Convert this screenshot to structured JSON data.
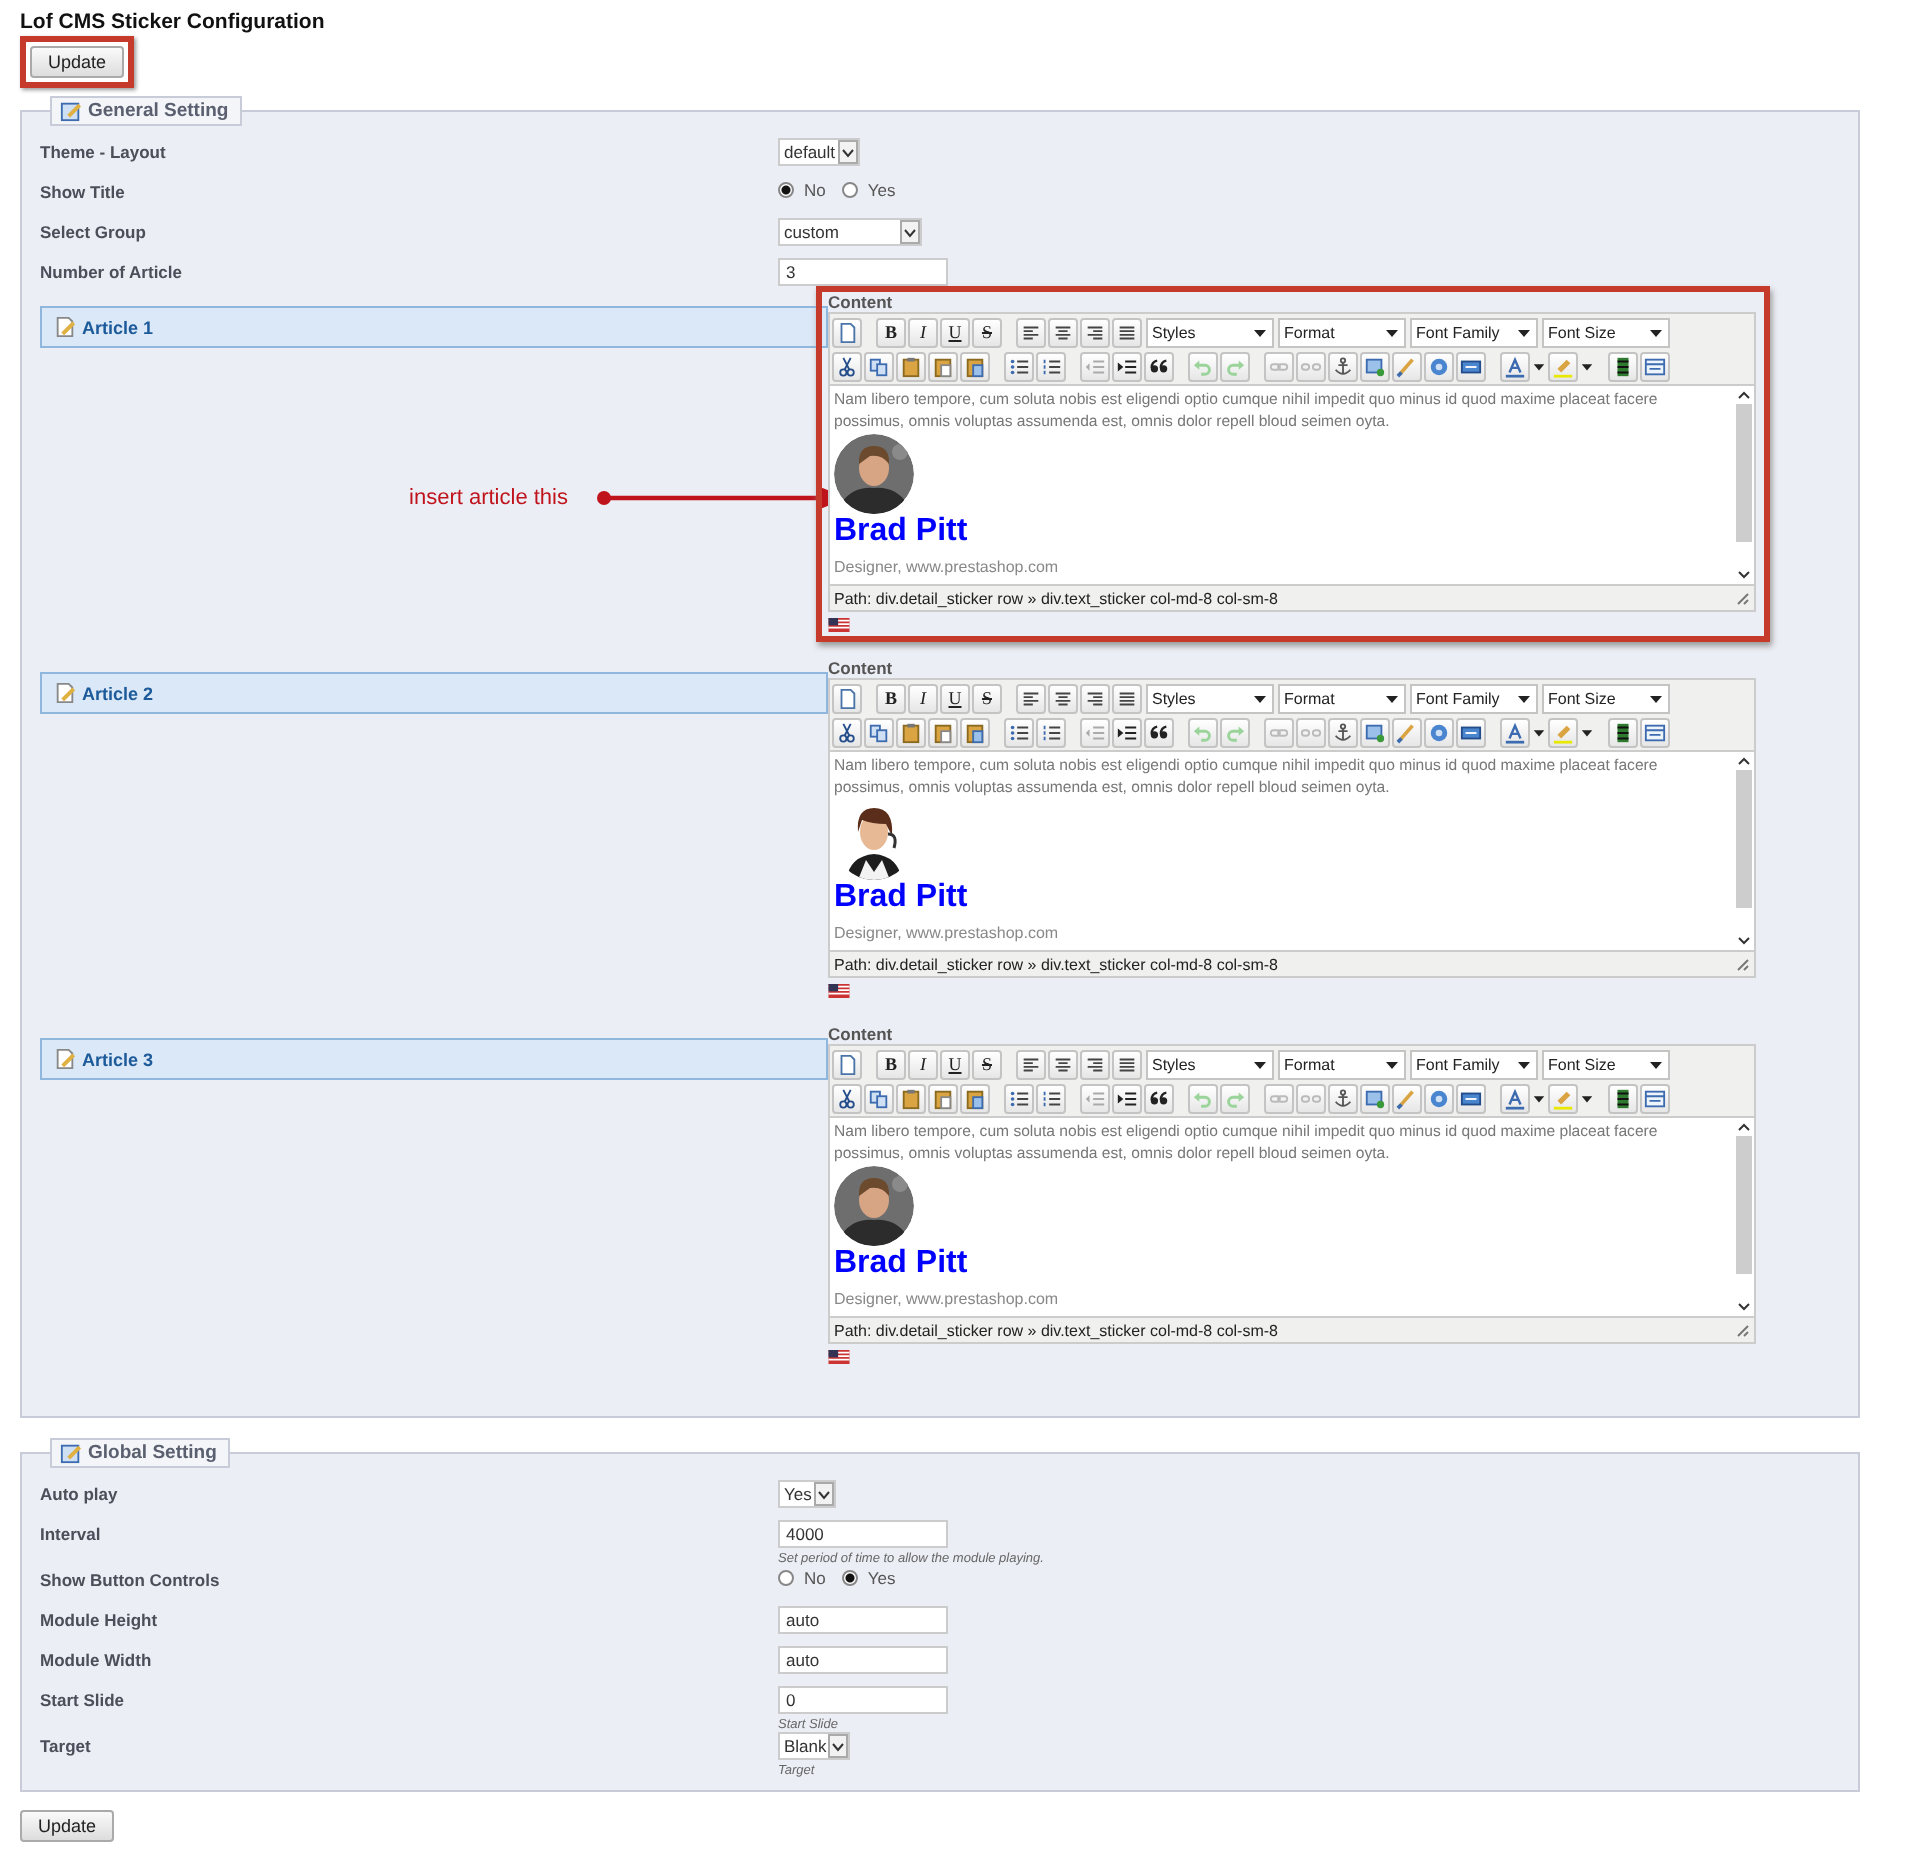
{
  "title": "Lof CMS Sticker Configuration",
  "top_button": {
    "label": "Update",
    "highlighted": true
  },
  "general_setting": {
    "legend": "General Setting",
    "fields": [
      {
        "kind": "select",
        "label": "Theme - Layout",
        "value": "default"
      },
      {
        "kind": "radio",
        "label": "Show Title",
        "options": [
          {
            "label": "No",
            "selected": true
          },
          {
            "label": "Yes",
            "selected": false
          }
        ]
      },
      {
        "kind": "dropdown",
        "label": "Select Group",
        "value": "custom"
      },
      {
        "kind": "text",
        "label": "Number of Article",
        "value": "3"
      }
    ],
    "articles": [
      {
        "title": "Article 1",
        "highlighted": true,
        "annotation": "insert article this",
        "editor": {
          "label": "Content",
          "format_buttons": [
            "B",
            "I",
            "U",
            "S"
          ],
          "dropdowns": [
            "Styles",
            "Format",
            "Font Family",
            "Font Size"
          ],
          "body": "Nam libero tempore, cum soluta nobis est eligendi optio cumque nihil impedit quo minus id quod maxime placeat facere possimus, omnis voluptas assumenda est, omnis dolor repell bloud seimen oyta.",
          "name": "Brad Pitt",
          "subtitle": "Designer, www.prestashop.com",
          "path": "Path: div.detail_sticker row » div.text_sticker col-md-8 col-sm-8"
        }
      },
      {
        "title": "Article 2",
        "highlighted": false,
        "editor": {
          "label": "Content",
          "format_buttons": [
            "B",
            "I",
            "U",
            "S"
          ],
          "dropdowns": [
            "Styles",
            "Format",
            "Font Family",
            "Font Size"
          ],
          "body": "Nam libero tempore, cum soluta nobis est eligendi optio cumque nihil impedit quo minus id quod maxime placeat facere possimus, omnis voluptas assumenda est, omnis dolor repell bloud seimen oyta.",
          "name": "Brad Pitt",
          "subtitle": "Designer, www.prestashop.com",
          "path": "Path: div.detail_sticker row » div.text_sticker col-md-8 col-sm-8"
        }
      },
      {
        "title": "Article 3",
        "highlighted": false,
        "editor": {
          "label": "Content",
          "format_buttons": [
            "B",
            "I",
            "U",
            "S"
          ],
          "dropdowns": [
            "Styles",
            "Format",
            "Font Family",
            "Font Size"
          ],
          "body": "Nam libero tempore, cum soluta nobis est eligendi optio cumque nihil impedit quo minus id quod maxime placeat facere possimus, omnis voluptas assumenda est, omnis dolor repell bloud seimen oyta.",
          "name": "Brad Pitt",
          "subtitle": "Designer, www.prestashop.com",
          "path": "Path: div.detail_sticker row » div.text_sticker col-md-8 col-sm-8"
        }
      }
    ]
  },
  "global_setting": {
    "legend": "Global Setting",
    "fields": [
      {
        "kind": "select",
        "label": "Auto play",
        "value": "Yes"
      },
      {
        "kind": "text",
        "label": "Interval",
        "value": "4000",
        "hint": "Set period of time to allow the module playing."
      },
      {
        "kind": "radio",
        "label": "Show Button Controls",
        "options": [
          {
            "label": "No",
            "selected": false
          },
          {
            "label": "Yes",
            "selected": true
          }
        ]
      },
      {
        "kind": "text",
        "label": "Module Height",
        "value": "auto"
      },
      {
        "kind": "text",
        "label": "Module Width",
        "value": "auto"
      },
      {
        "kind": "text",
        "label": "Start Slide",
        "value": "0",
        "hint": "Start Slide"
      },
      {
        "kind": "select",
        "label": "Target",
        "value": "Blank",
        "hint": "Target"
      }
    ]
  },
  "bottom_button": {
    "label": "Update"
  }
}
